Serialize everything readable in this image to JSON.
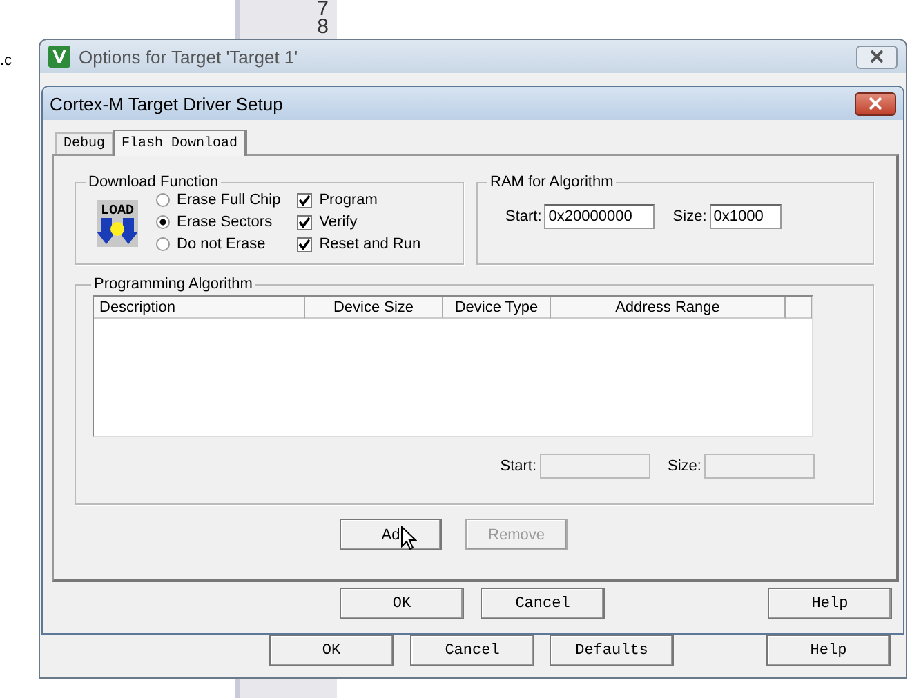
{
  "editor": {
    "file_fragment": ".c",
    "line_numbers": [
      "7",
      "8"
    ]
  },
  "outer_window": {
    "title": "Options for Target 'Target 1'",
    "buttons": [
      {
        "label": "OK"
      },
      {
        "label": "Cancel"
      },
      {
        "label": "Defaults"
      },
      {
        "label": "Help"
      }
    ]
  },
  "dialog": {
    "title": "Cortex-M Target Driver Setup",
    "tabs": [
      {
        "label": "Debug",
        "selected": false
      },
      {
        "label": "Flash Download",
        "selected": true
      }
    ],
    "download_function": {
      "title": "Download Function",
      "icon_text": "LOAD",
      "erase_options": [
        {
          "label": "Erase Full Chip",
          "selected": false
        },
        {
          "label": "Erase Sectors",
          "selected": true
        },
        {
          "label": "Do not Erase",
          "selected": false
        }
      ],
      "checks": [
        {
          "label": "Program",
          "checked": true
        },
        {
          "label": "Verify",
          "checked": true
        },
        {
          "label": "Reset and Run",
          "checked": true
        }
      ]
    },
    "ram": {
      "title": "RAM for Algorithm",
      "start_label": "Start:",
      "start": "0x20000000",
      "size_label": "Size:",
      "size": "0x1000"
    },
    "algorithm": {
      "title": "Programming Algorithm",
      "columns": [
        "Description",
        "Device Size",
        "Device Type",
        "Address Range"
      ],
      "start_label": "Start:",
      "size_label": "Size:"
    },
    "actions": [
      {
        "label": "Ad",
        "disabled": false
      },
      {
        "label": "Remove",
        "disabled": true
      }
    ],
    "buttons": [
      {
        "label": "OK"
      },
      {
        "label": "Cancel"
      },
      {
        "label": "Help"
      }
    ]
  }
}
